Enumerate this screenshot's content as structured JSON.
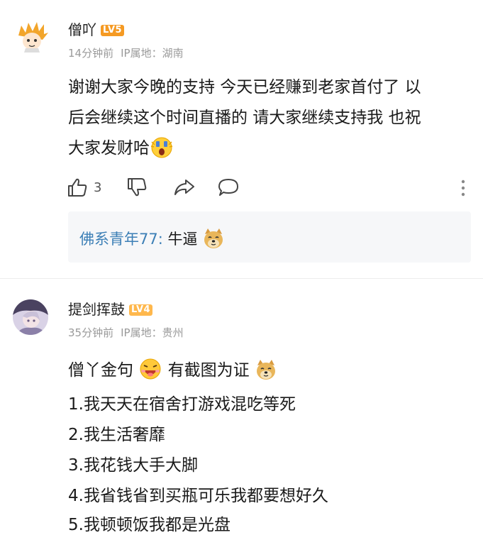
{
  "comments": [
    {
      "username": "僧吖",
      "level": "LV5",
      "time": "14分钟前",
      "ip_location": "IP属地：湖南",
      "body_lines": [
        "谢谢大家今晚的支持 今天已经赚到老家首付了 以",
        "后会继续这个时间直播的 请大家继续支持我 也祝",
        "大家发财哈"
      ],
      "like_count": "3",
      "reply": {
        "username": "佛系青年77:",
        "text": "牛逼"
      }
    },
    {
      "username": "提剑挥鼓",
      "level": "LV4",
      "time": "35分钟前",
      "ip_location": "IP属地：贵州",
      "intro_part1": "僧丫金句",
      "intro_part2": "有截图为证",
      "items": [
        "1.我天天在宿舍打游戏混吃等死",
        "2.我生活奢靡",
        "3.我花钱大手大脚",
        "4.我省钱省到买瓶可乐我都要想好久",
        "5.我顿顿饭我都是光盘"
      ]
    }
  ],
  "colors": {
    "level5": "#f59a23",
    "level4": "#ffb84d",
    "reply_name": "#3c7fb6",
    "meta": "#9a9a9a"
  }
}
